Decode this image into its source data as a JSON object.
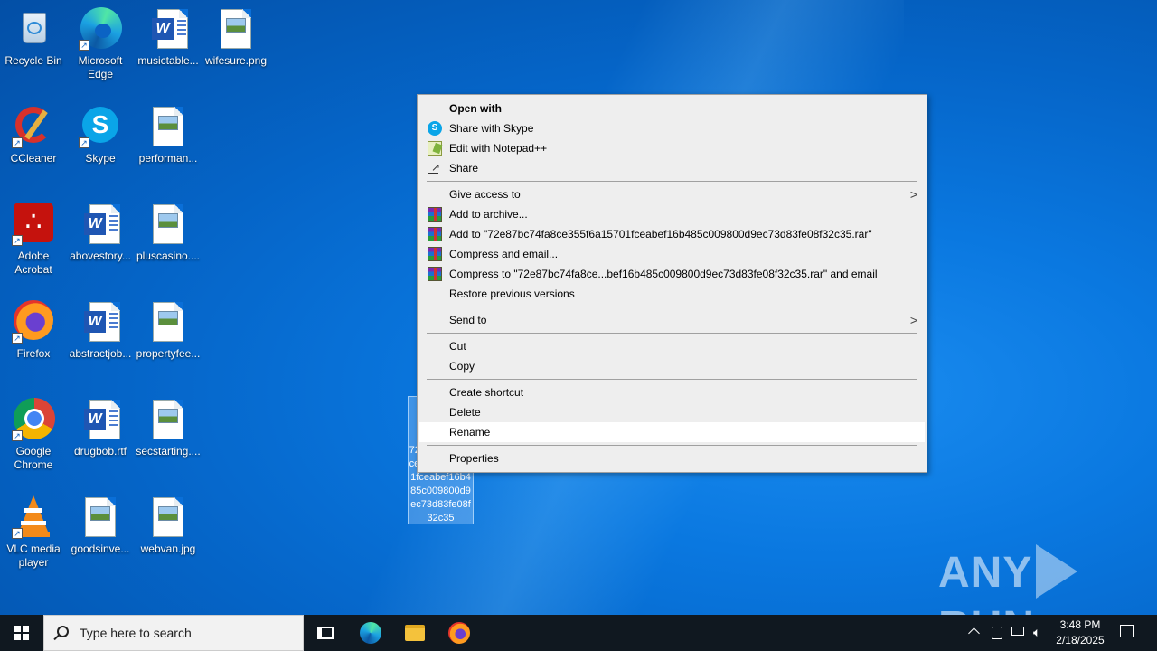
{
  "desktop": {
    "icons": [
      {
        "label": "Recycle Bin",
        "icon": "recycle-bin-icon"
      },
      {
        "label": "Microsoft Edge",
        "icon": "edge-icon"
      },
      {
        "label": "musictable...",
        "icon": "word-doc-icon"
      },
      {
        "label": "wifesure.png",
        "icon": "image-file-icon"
      },
      {
        "label": "CCleaner",
        "icon": "ccleaner-icon"
      },
      {
        "label": "Skype",
        "icon": "skype-icon"
      },
      {
        "label": "performan...",
        "icon": "image-file-icon"
      },
      {
        "label": "Adobe Acrobat",
        "icon": "acrobat-icon"
      },
      {
        "label": "abovestory...",
        "icon": "word-doc-icon"
      },
      {
        "label": "pluscasino....",
        "icon": "image-file-icon"
      },
      {
        "label": "Firefox",
        "icon": "firefox-icon"
      },
      {
        "label": "abstractjob...",
        "icon": "word-doc-icon"
      },
      {
        "label": "propertyfee...",
        "icon": "image-file-icon"
      },
      {
        "label": "Google Chrome",
        "icon": "chrome-icon"
      },
      {
        "label": "drugbob.rtf",
        "icon": "word-doc-icon"
      },
      {
        "label": "secstarting....",
        "icon": "image-file-icon"
      },
      {
        "label": "VLC media player",
        "icon": "vlc-icon"
      },
      {
        "label": "goodsinve...",
        "icon": "image-file-icon"
      },
      {
        "label": "webvan.jpg",
        "icon": "image-file-icon"
      }
    ],
    "selected_file_label": "72e87bc74fa8ce355f6a15701fceabef16b485c009800d9ec73d83fe08f32c35"
  },
  "context_menu": {
    "items": [
      {
        "label": "Open with",
        "icon": "",
        "bold": true
      },
      {
        "label": "Share with Skype",
        "icon": "skype-icon"
      },
      {
        "label": "Edit with Notepad++",
        "icon": "notepadpp-icon"
      },
      {
        "label": "Share",
        "icon": "share-icon"
      },
      {
        "label": "Give access to",
        "icon": "",
        "submenu": true
      },
      {
        "label": "Add to archive...",
        "icon": "winrar-icon"
      },
      {
        "label": "Add to \"72e87bc74fa8ce355f6a15701fceabef16b485c009800d9ec73d83fe08f32c35.rar\"",
        "icon": "winrar-icon"
      },
      {
        "label": "Compress and email...",
        "icon": "winrar-icon"
      },
      {
        "label": "Compress to \"72e87bc74fa8ce...bef16b485c009800d9ec73d83fe08f32c35.rar\" and email",
        "icon": "winrar-icon"
      },
      {
        "label": "Restore previous versions",
        "icon": ""
      },
      {
        "label": "Send to",
        "icon": "",
        "submenu": true
      },
      {
        "label": "Cut",
        "icon": ""
      },
      {
        "label": "Copy",
        "icon": ""
      },
      {
        "label": "Create shortcut",
        "icon": ""
      },
      {
        "label": "Delete",
        "icon": ""
      },
      {
        "label": "Rename",
        "icon": "",
        "highlighted": true
      },
      {
        "label": "Properties",
        "icon": ""
      }
    ],
    "submenu_arrow": ">"
  },
  "watermark": {
    "left": "ANY",
    "right": "RUN"
  },
  "taskbar": {
    "search_placeholder": "Type here to search",
    "time": "3:48 PM",
    "date": "2/18/2025",
    "tray_chevron": "^"
  }
}
